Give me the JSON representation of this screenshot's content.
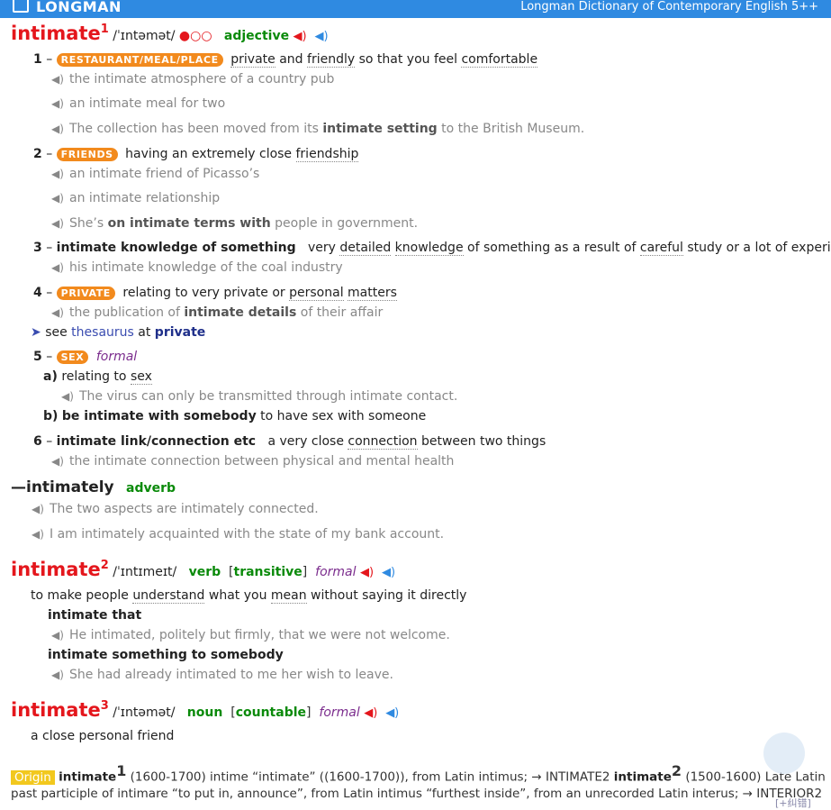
{
  "header": {
    "logo": "LONGMAN",
    "title": "Longman Dictionary of Contemporary English 5++"
  },
  "e1": {
    "hw": "intimate",
    "hom": "1",
    "pron": "/ˈɪntəmət/",
    "freq": "●○○",
    "pos": "adjective",
    "s1": {
      "num": "1",
      "badge": "RESTAURANT/MEAL/PLACE",
      "def": [
        [
          "private",
          true
        ],
        [
          " and ",
          false
        ],
        [
          "friendly",
          true
        ],
        [
          " so that you feel ",
          false
        ],
        [
          "comfortable",
          true
        ]
      ],
      "ex1": "the intimate atmosphere of a country pub",
      "ex2": "an intimate meal for two",
      "ex3a": "The collection has been moved from its ",
      "ex3b": "intimate setting",
      "ex3c": " to the British Museum."
    },
    "s2": {
      "num": "2",
      "badge": "FRIENDS",
      "defa": "having an extremely close ",
      "defb": "friendship",
      "ex1": "an intimate friend of Picasso’s",
      "ex2": "an intimate relationship",
      "ex3a": "She’s ",
      "ex3b": "on intimate terms with",
      "ex3c": " people in government."
    },
    "s3": {
      "num": "3",
      "lu": "intimate knowledge of something",
      "def": [
        [
          "very ",
          false
        ],
        [
          "detailed",
          true
        ],
        [
          " ",
          false
        ],
        [
          "knowledge",
          true
        ],
        [
          " of something as a result of ",
          false
        ],
        [
          "careful",
          true
        ],
        [
          " study or a lot of experience",
          false
        ]
      ],
      "ex1": "his intimate knowledge of the coal industry"
    },
    "s4": {
      "num": "4",
      "badge": "PRIVATE",
      "defa": "relating to very private or ",
      "defb": "personal",
      "defc": " ",
      "defd": "matters",
      "ex1a": "the publication of ",
      "ex1b": "intimate details",
      "ex1c": " of their affair"
    },
    "see": {
      "pre": "see ",
      "thes": "thesaurus",
      "at": " at ",
      "target": "private"
    },
    "s5": {
      "num": "5",
      "badge": "SEX",
      "reg": "formal",
      "a": {
        "label": "a)",
        "defa": "relating to ",
        "defb": "sex",
        "ex": "The virus can only be transmitted through intimate contact."
      },
      "b": {
        "label": "b)",
        "lu": "be intimate with somebody",
        "def": " to have sex with someone"
      }
    },
    "s6": {
      "num": "6",
      "lu": "intimate link/connection etc",
      "defa": "a very close ",
      "defb": "connection",
      "defc": " between two things",
      "ex1": "the intimate connection between physical and mental health"
    }
  },
  "runon": {
    "word": "—intimately",
    "pos": "adverb",
    "ex1": "The two aspects are intimately connected.",
    "ex2": "I am intimately acquainted with the state of my bank account."
  },
  "e2": {
    "hw": "intimate",
    "hom": "2",
    "pron": "/ˈɪntɪmeɪt/",
    "pos": "verb",
    "gram": "transitive",
    "reg": "formal",
    "defa": "to make people ",
    "defb": "understand",
    "defc": " what you ",
    "defd": "mean",
    "defe": " without saying it directly",
    "p1": "intimate that",
    "ex1": "He intimated, politely but firmly, that we were not welcome.",
    "p2": "intimate something to somebody",
    "ex2": "She had already intimated to me her wish to leave."
  },
  "e3": {
    "hw": "intimate",
    "hom": "3",
    "pron": "/ˈɪntəmət/",
    "pos": "noun",
    "gram": "countable",
    "reg": "formal",
    "def": "a close personal friend"
  },
  "origin": {
    "badge": "Origin",
    "w1": "intimate",
    "n1": "1",
    "t1": " (1600-1700) intime “intimate” ((1600-1700)), from Latin intimus; → INTIMATE2 ",
    "w2": "intimate",
    "n2": "2",
    "t2": " (1500-1600) Late Latin",
    "line2": "past participle of intimare “to put in, announce”, from Latin intimus “furthest inside”, from an unrecorded Latin interus; → INTERIOR2"
  },
  "corner_link": "[+纠错]",
  "icons": {
    "speaker": "speaker-icon",
    "pointer": "arrow-pointer-icon"
  }
}
